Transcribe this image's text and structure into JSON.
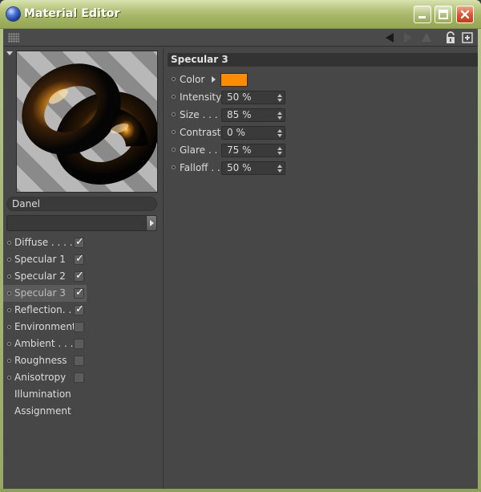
{
  "window": {
    "title": "Material Editor",
    "icon": "cinema4d-orb-icon",
    "controls": [
      "minimize-icon",
      "maximize-icon",
      "close-icon"
    ]
  },
  "toolbar": {
    "icons": [
      "back-arrow-icon",
      "forward-arrow-icon",
      "up-arrow-icon",
      "lock-icon",
      "new-window-icon"
    ]
  },
  "material": {
    "name": "Danel"
  },
  "channels": [
    {
      "label": "Diffuse . . . .",
      "checked": true
    },
    {
      "label": "Specular 1",
      "checked": true
    },
    {
      "label": "Specular 2",
      "checked": true
    },
    {
      "label": "Specular 3",
      "checked": true,
      "active": true
    },
    {
      "label": "Reflection. .",
      "checked": true
    },
    {
      "label": "Environment",
      "checked": false
    },
    {
      "label": "Ambient . . .",
      "checked": false
    },
    {
      "label": "Roughness",
      "checked": false
    },
    {
      "label": "Anisotropy",
      "checked": false
    },
    {
      "label": "Illumination",
      "checked": null
    },
    {
      "label": "Assignment",
      "checked": null
    }
  ],
  "panel": {
    "title": "Specular 3",
    "color_label": "Color",
    "color_value": "#ff8c00",
    "params": [
      {
        "label": "Intensity",
        "value": "50 %"
      },
      {
        "label": "Size . . .",
        "value": "85 %"
      },
      {
        "label": "Contrast",
        "value": "0 %"
      },
      {
        "label": "Glare . .",
        "value": "75 %"
      },
      {
        "label": "Falloff . .",
        "value": "50 %"
      }
    ]
  }
}
